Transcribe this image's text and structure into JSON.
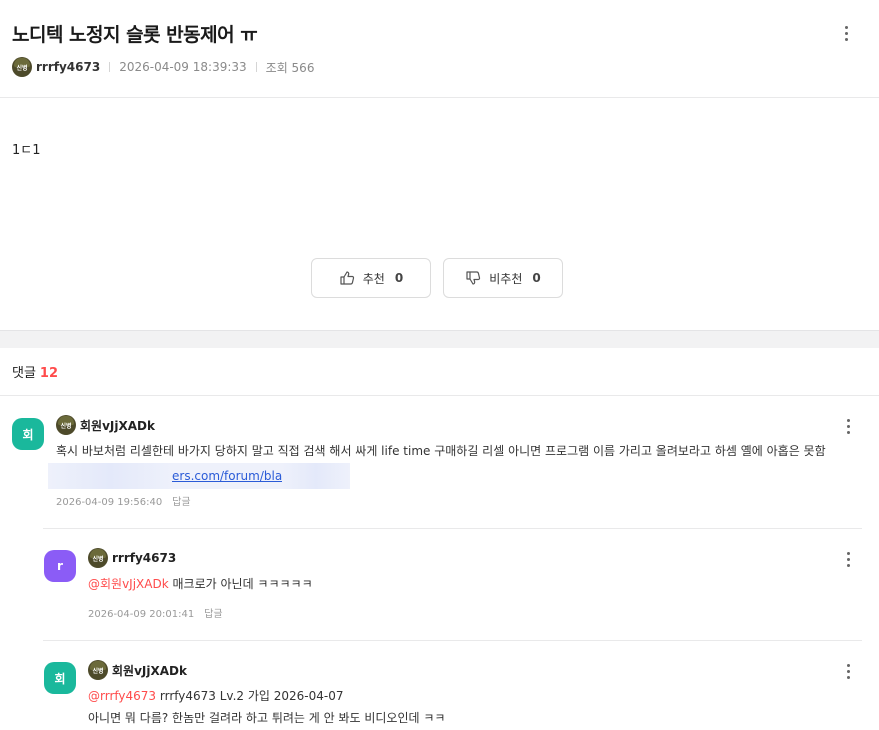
{
  "post": {
    "title": "노디텍 노정지 슬롯 반동제어 ㅠ",
    "badge_text": "신병",
    "author": "rrrfy4673",
    "datetime": "2026-04-09 18:39:33",
    "views": "조회 566",
    "body": "1ㄷ1",
    "upvote_label": "추천",
    "upvote_count": "0",
    "downvote_label": "비추천",
    "downvote_count": "0"
  },
  "comments_header": {
    "label": "댓글",
    "count": "12"
  },
  "comments": [
    {
      "avatar_letter": "회",
      "avatar_color": "#1ab89c",
      "badge_text": "신병",
      "author": "회원vJjXADk",
      "text": "혹시 바보처럼 리셀한테 바가지 당하지 말고 직접 검색 해서 싸게 life time 구매하길 리셀 아니면 프로그램 이름 가리고 올려보라고 하셈 옐에 아홉은 못함",
      "link_text": "ers.com/forum/bla",
      "datetime": "2026-04-09 19:56:40",
      "reply_label": "답글"
    },
    {
      "avatar_letter": "r",
      "avatar_color": "#8b5cf6",
      "badge_text": "신병",
      "author": "rrrfy4673",
      "mention": "@회원vJjXADk",
      "text": "매크로가 아닌데 ㅋㅋㅋㅋㅋ",
      "datetime": "2026-04-09 20:01:41",
      "reply_label": "답글"
    },
    {
      "avatar_letter": "회",
      "avatar_color": "#1ab89c",
      "badge_text": "신병",
      "author": "회원vJjXADk",
      "mention": "@rrrfy4673",
      "text": "rrrfy4673 Lv.2 가입 2026-04-07",
      "text2": "아니면 뭐 다름? 한놈만 걸려라 하고 튀려는 게 안 봐도 비디오인데 ㅋㅋ"
    }
  ],
  "colors": {
    "accent_red": "#ff4b4b",
    "link_blue": "#2a5bd7"
  },
  "icons": [
    "more-vertical-icon",
    "thumbs-up-icon",
    "thumbs-down-icon",
    "rank-badge-icon"
  ]
}
